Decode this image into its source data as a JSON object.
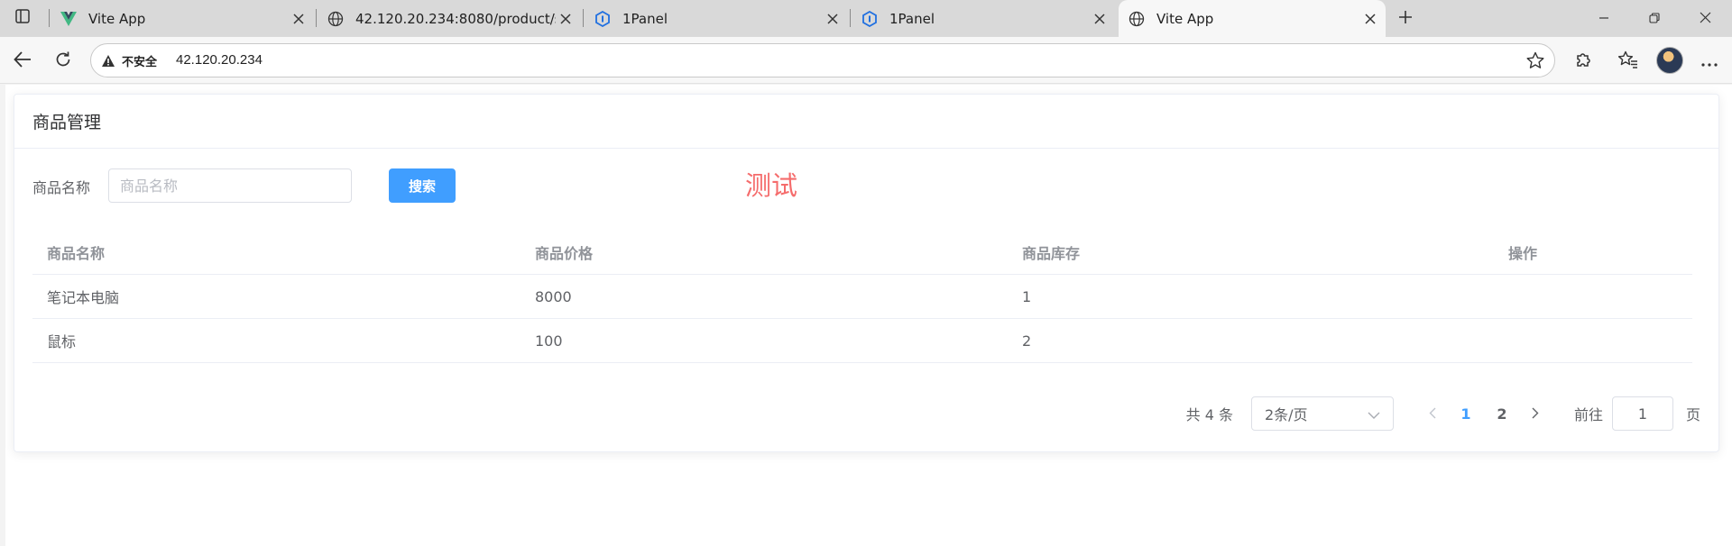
{
  "browser": {
    "tabs": [
      {
        "title": "Vite App",
        "favicon": "vue-icon",
        "active": false
      },
      {
        "title": "42.120.20.234:8080/product/selec",
        "favicon": "globe-icon",
        "active": false
      },
      {
        "title": "1Panel",
        "favicon": "1panel-icon",
        "active": false
      },
      {
        "title": "1Panel",
        "favicon": "1panel-icon",
        "active": false
      },
      {
        "title": "Vite App",
        "favicon": "globe-icon",
        "active": true
      }
    ],
    "address": {
      "security_label": "不安全",
      "url": "42.120.20.234"
    },
    "colors": {
      "tabstrip": "#d9d9d9",
      "toolbar": "#f7f7f7"
    }
  },
  "page": {
    "card_title": "商品管理",
    "form": {
      "label": "商品名称",
      "placeholder": "商品名称",
      "value": "",
      "search_button": "搜索",
      "test_text": "测试"
    },
    "table": {
      "headers": [
        "商品名称",
        "商品价格",
        "商品库存",
        "操作"
      ],
      "rows": [
        [
          "笔记本电脑",
          "8000",
          "1",
          ""
        ],
        [
          "鼠标",
          "100",
          "2",
          ""
        ]
      ]
    },
    "pagination": {
      "total": "共 4 条",
      "page_size": "2条/页",
      "pages": [
        "1",
        "2"
      ],
      "current_page": "1",
      "goto_label": "前往",
      "goto_value": "1",
      "goto_suffix": "页"
    },
    "colors": {
      "primary": "#409eff",
      "danger": "#f56c6c"
    }
  }
}
